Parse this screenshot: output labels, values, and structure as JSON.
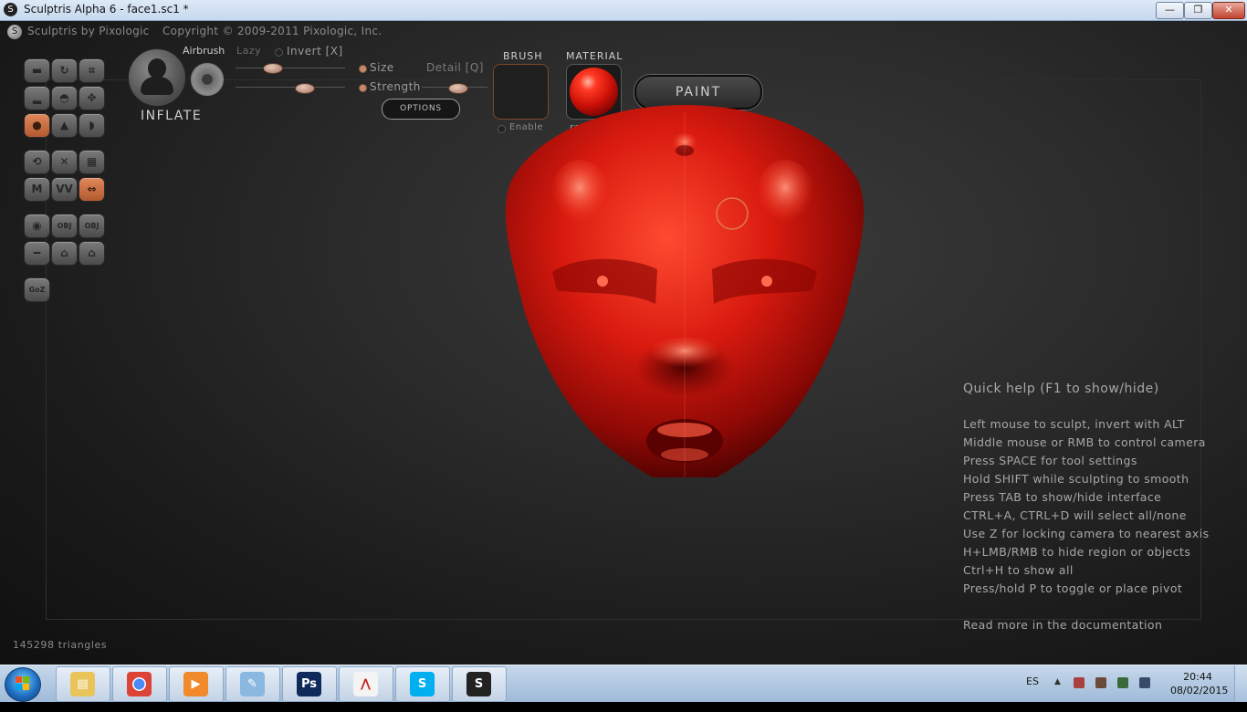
{
  "window": {
    "title": "Sculptris Alpha 6 - face1.sc1 *",
    "minimize_label": "—",
    "maximize_label": "❐",
    "close_label": "✕"
  },
  "app": {
    "name": "Sculptris by Pixologic",
    "copyright": "Copyright © 2009-2011 Pixologic, Inc."
  },
  "tools": {
    "rows": [
      [
        "crease",
        "rotate",
        "crop"
      ],
      [
        "flatten",
        "grab",
        "move"
      ],
      [
        "inflate",
        "pinch",
        "smooth"
      ],
      [
        "reduce",
        "mask",
        "subdivide"
      ],
      [
        "m",
        "wave",
        "symmetry"
      ],
      [
        "material",
        "obj-import",
        "obj-export"
      ],
      [
        "plane",
        "save",
        "load"
      ],
      [
        "goz"
      ]
    ],
    "labels": {
      "m": "M",
      "wave": "VV",
      "obj-import": "OBJ",
      "obj-export": "OBJ",
      "goz": "GoZ",
      "symmetry": "⇔"
    }
  },
  "brush": {
    "name": "INFLATE",
    "airbrush_label": "Airbrush",
    "lazy_label": "Lazy",
    "invert_label": "Invert [X]",
    "size_label": "Size",
    "strength_label": "Strength",
    "detail_label": "Detail [Q]",
    "options_label": "OPTIONS",
    "size_value": 0.3,
    "strength_value": 0.65,
    "detail_value": 0.55
  },
  "brush_panel": {
    "label": "BRUSH",
    "enable_label": "Enable"
  },
  "material_panel": {
    "label": "MATERIAL",
    "name": "red_bob"
  },
  "paint_button": "PAINT",
  "help": {
    "title": "Quick help (F1 to show/hide)",
    "lines": [
      "Left mouse to sculpt, invert with ALT",
      "Middle mouse or RMB to control camera",
      "Press SPACE for tool settings",
      "Hold SHIFT while sculpting to smooth",
      "Press TAB to show/hide interface",
      "CTRL+A, CTRL+D will select all/none",
      "Use Z for locking camera to nearest axis",
      "H+LMB/RMB to hide region or objects",
      "Ctrl+H to show all",
      "Press/hold P to toggle or place pivot"
    ],
    "footer": "Read more in the documentation"
  },
  "status": {
    "triangles": "145298 triangles"
  },
  "taskbar": {
    "apps": [
      "explorer",
      "chrome",
      "media-player",
      "notepad",
      "photoshop",
      "acrobat",
      "skype",
      "sculptris"
    ],
    "app_labels": {
      "photoshop": "Ps"
    },
    "language": "ES",
    "time": "20:44",
    "date": "08/02/2015"
  },
  "colors": {
    "model_red": "#d01a10",
    "accent_orange": "#c8683a"
  }
}
